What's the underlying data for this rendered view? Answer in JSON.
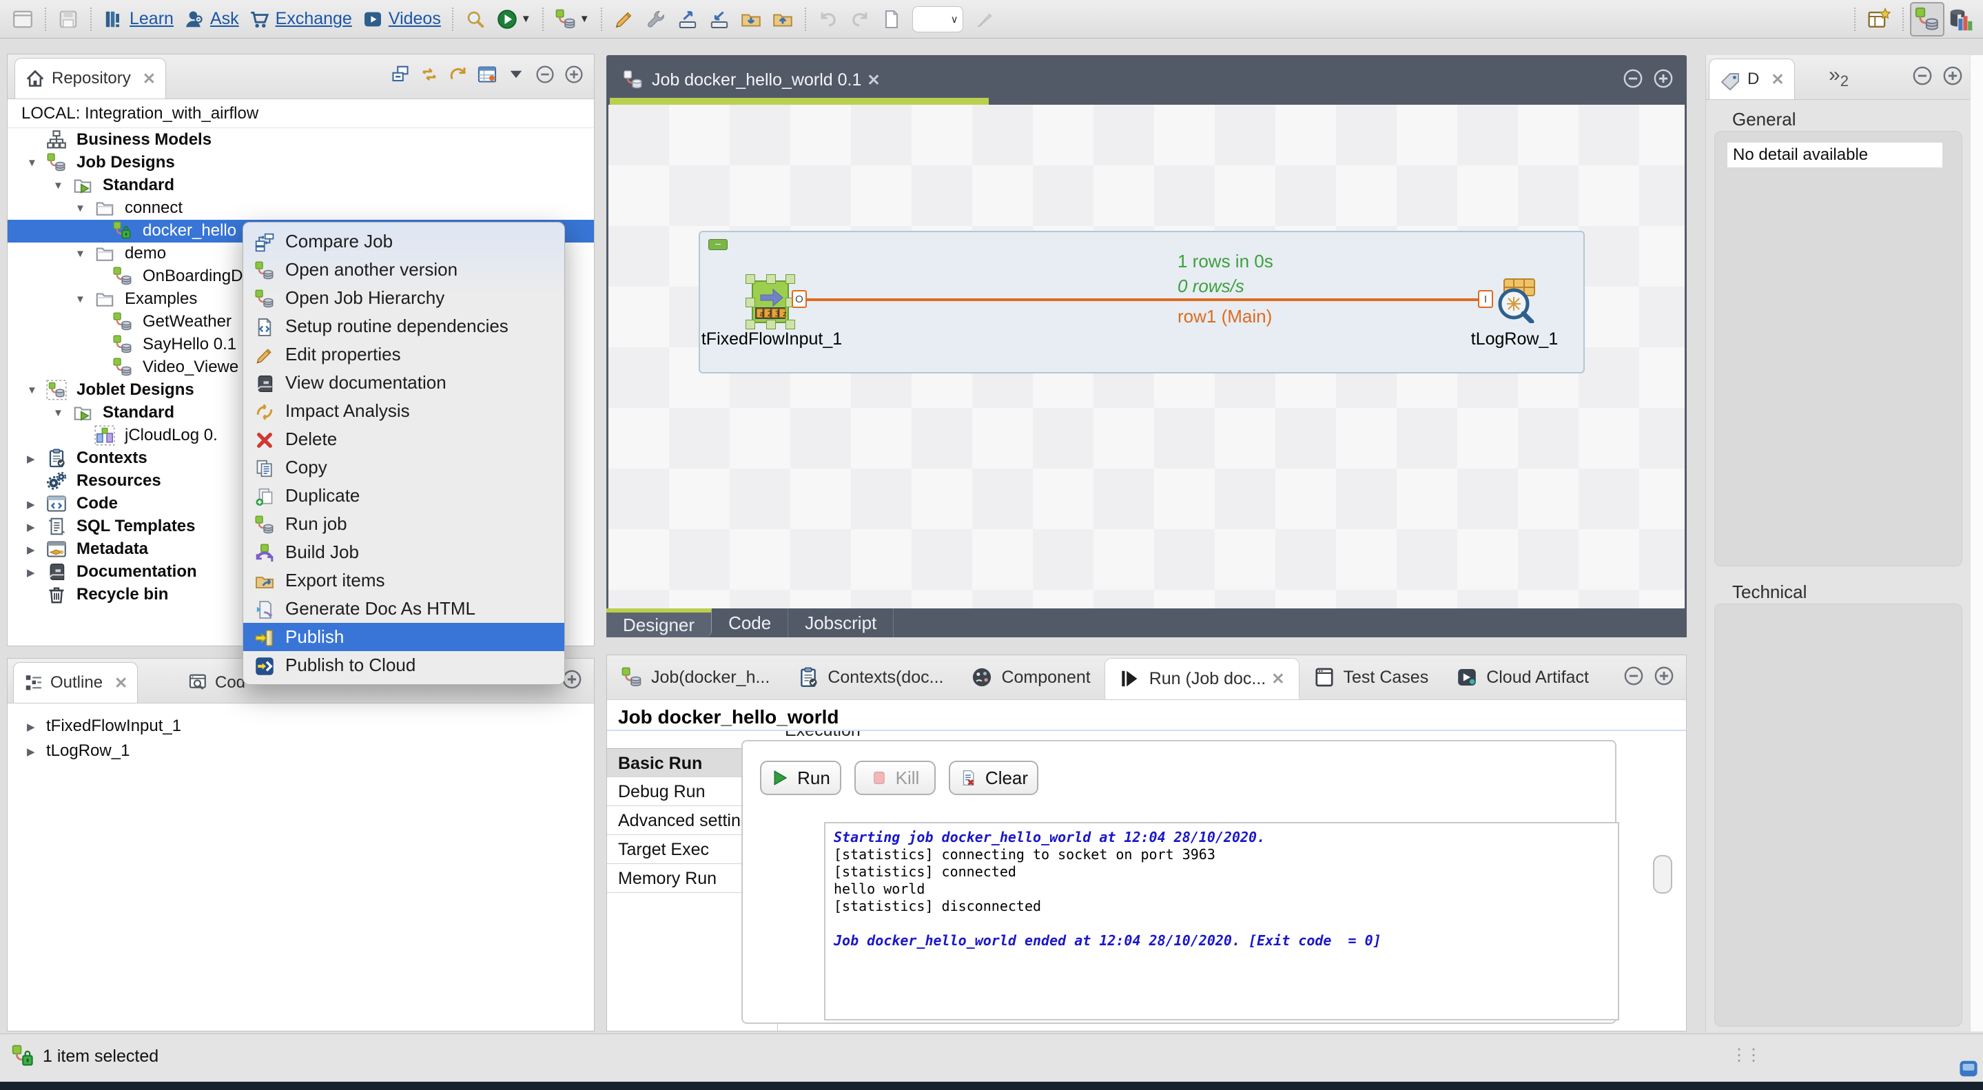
{
  "colors": {
    "selection_blue": "#3875d6",
    "tab_bar_dark": "#525a68",
    "accent_green": "#b9cf4d",
    "connection_orange": "#dd6b1e",
    "stats_green": "#3da03d",
    "console_info_blue": "#1a16c8"
  },
  "toolbar": {
    "links": [
      {
        "label": "Learn"
      },
      {
        "label": "Ask"
      },
      {
        "label": "Exchange"
      },
      {
        "label": "Videos"
      }
    ]
  },
  "repository": {
    "tab_title": "Repository",
    "project_label": "LOCAL: Integration_with_airflow",
    "tree": [
      {
        "label": "Business Models",
        "level": 1,
        "icon": "business-models",
        "bold": true,
        "expander": "none"
      },
      {
        "label": "Job Designs",
        "level": 1,
        "icon": "job",
        "bold": true,
        "expander": "open"
      },
      {
        "label": "Standard",
        "level": 2,
        "icon": "folder-run",
        "bold": true,
        "expander": "open"
      },
      {
        "label": "connect",
        "level": 3,
        "icon": "folder",
        "bold": false,
        "expander": "open"
      },
      {
        "label": "docker_hello",
        "level": 4,
        "icon": "job-lock",
        "bold": false,
        "expander": "none",
        "selected": true
      },
      {
        "label": "demo",
        "level": 3,
        "icon": "folder",
        "bold": false,
        "expander": "open"
      },
      {
        "label": "OnBoardingD",
        "level": 4,
        "icon": "job",
        "bold": false,
        "expander": "none"
      },
      {
        "label": "Examples",
        "level": 3,
        "icon": "folder",
        "bold": false,
        "expander": "open"
      },
      {
        "label": "GetWeather",
        "level": 4,
        "icon": "job",
        "bold": false,
        "expander": "none"
      },
      {
        "label": "SayHello 0.1",
        "level": 4,
        "icon": "job",
        "bold": false,
        "expander": "none"
      },
      {
        "label": "Video_Viewe",
        "level": 4,
        "icon": "job",
        "bold": false,
        "expander": "none"
      },
      {
        "label": "Joblet Designs",
        "level": 1,
        "icon": "joblet",
        "bold": true,
        "expander": "open"
      },
      {
        "label": "Standard",
        "level": 2,
        "icon": "folder-run",
        "bold": true,
        "expander": "open"
      },
      {
        "label": "jCloudLog 0.",
        "level": 3,
        "icon": "joblet-item",
        "bold": false,
        "expander": "none"
      },
      {
        "label": "Contexts",
        "level": 1,
        "icon": "contexts",
        "bold": true,
        "expander": "closed"
      },
      {
        "label": "Resources",
        "level": 1,
        "icon": "resources",
        "bold": true,
        "expander": "none"
      },
      {
        "label": "Code",
        "level": 1,
        "icon": "code",
        "bold": true,
        "expander": "closed"
      },
      {
        "label": "SQL Templates",
        "level": 1,
        "icon": "sql",
        "bold": true,
        "expander": "closed"
      },
      {
        "label": "Metadata",
        "level": 1,
        "icon": "metadata",
        "bold": true,
        "expander": "closed"
      },
      {
        "label": "Documentation",
        "level": 1,
        "icon": "documentation",
        "bold": true,
        "expander": "closed"
      },
      {
        "label": "Recycle bin",
        "level": 1,
        "icon": "trash",
        "bold": true,
        "expander": "none"
      }
    ]
  },
  "context_menu": {
    "items": [
      {
        "label": "Compare Job",
        "icon": "compare-job"
      },
      {
        "label": "Open another version",
        "icon": "job"
      },
      {
        "label": "Open Job Hierarchy",
        "icon": "job"
      },
      {
        "label": "Setup routine dependencies",
        "icon": "routine-file"
      },
      {
        "label": "Edit properties",
        "icon": "pencil"
      },
      {
        "label": "View documentation",
        "icon": "documentation"
      },
      {
        "label": "Impact Analysis",
        "icon": "impact"
      },
      {
        "label": "Delete",
        "icon": "delete"
      },
      {
        "label": "Copy",
        "icon": "copy"
      },
      {
        "label": "Duplicate",
        "icon": "duplicate"
      },
      {
        "label": "Run job",
        "icon": "job"
      },
      {
        "label": "Build Job",
        "icon": "build"
      },
      {
        "label": "Export items",
        "icon": "export-items"
      },
      {
        "label": "Generate Doc As HTML",
        "icon": "generate-doc"
      },
      {
        "label": "Publish",
        "icon": "publish",
        "highlighted": true
      },
      {
        "label": "Publish to Cloud",
        "icon": "publish-cloud"
      }
    ]
  },
  "editor": {
    "tab_title": "Job docker_hello_world 0.1",
    "bottom_tabs": [
      {
        "label": "Designer",
        "active": true
      },
      {
        "label": "Code",
        "active": false
      },
      {
        "label": "Jobscript",
        "active": false
      }
    ],
    "canvas": {
      "components": [
        {
          "name": "tFixedFlowInput_1"
        },
        {
          "name": "tLogRow_1"
        }
      ],
      "connection": {
        "rows_label": "1 rows in 0s",
        "rate_label": "0 rows/s",
        "row_label": "row1 (Main)",
        "start_badge": "O",
        "end_badge": "I"
      }
    }
  },
  "bottom_panel": {
    "tabs": [
      {
        "label": "Job(docker_h...",
        "icon": "job",
        "active": false
      },
      {
        "label": "Contexts(doc...",
        "icon": "contexts",
        "active": false
      },
      {
        "label": "Component",
        "icon": "component",
        "active": false
      },
      {
        "label": "Run (Job doc...",
        "icon": "run-tab",
        "active": true
      },
      {
        "label": "Test Cases",
        "icon": "test-cases",
        "active": false
      },
      {
        "label": "Cloud Artifact",
        "icon": "cloud-artifact",
        "active": false
      }
    ],
    "run_view": {
      "title": "Job docker_hello_world",
      "group_label": "Execution",
      "nav": [
        {
          "label": "Basic Run",
          "selected": true
        },
        {
          "label": "Debug Run",
          "selected": false
        },
        {
          "label": "Advanced settings",
          "selected": false
        },
        {
          "label": "Target Exec",
          "selected": false
        },
        {
          "label": "Memory Run",
          "selected": false
        }
      ],
      "buttons": [
        {
          "label": "Run",
          "disabled": false
        },
        {
          "label": "Kill",
          "disabled": true
        },
        {
          "label": "Clear",
          "disabled": false
        }
      ],
      "console": [
        {
          "text": "Starting job docker_hello_world at 12:04 28/10/2020.",
          "style": "info"
        },
        {
          "text": "[statistics] connecting to socket on port 3963",
          "style": "plain"
        },
        {
          "text": "[statistics] connected",
          "style": "plain"
        },
        {
          "text": "hello world",
          "style": "plain"
        },
        {
          "text": "[statistics] disconnected",
          "style": "plain"
        },
        {
          "text": "",
          "style": "plain"
        },
        {
          "text": "Job docker_hello_world ended at 12:04 28/10/2020. [Exit code  = 0]",
          "style": "info"
        }
      ]
    }
  },
  "right_panel": {
    "tab_title": "D",
    "overflow_count": "2",
    "sections": [
      {
        "label": "General",
        "field": "No detail available"
      },
      {
        "label": "Technical",
        "field": ""
      }
    ]
  },
  "outline": {
    "tab_title": "Outline",
    "second_tab_title": "Cod",
    "items": [
      {
        "label": "tFixedFlowInput_1"
      },
      {
        "label": "tLogRow_1"
      }
    ]
  },
  "status_bar": {
    "text": "1 item selected"
  }
}
